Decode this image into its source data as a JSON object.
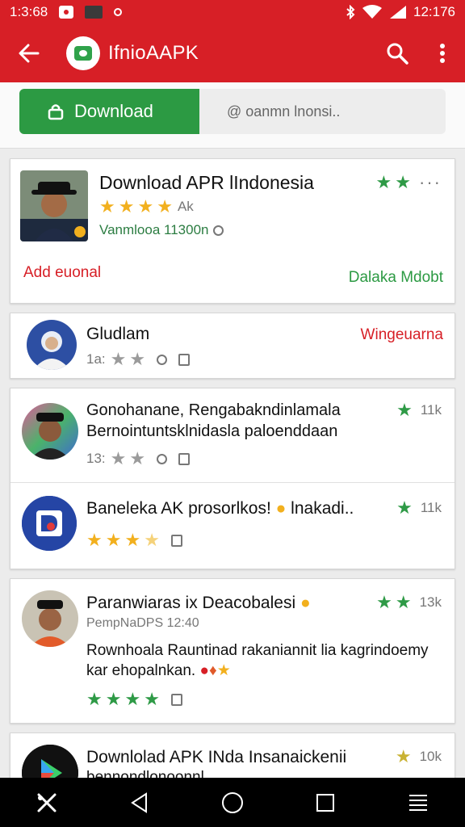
{
  "status_bar": {
    "time_left": "1:3:68",
    "time_right": "12:176"
  },
  "app_bar": {
    "title": "IfnioAAPK"
  },
  "actions": {
    "download_label": "Download",
    "search_placeholder": "@ oanmn lnonsi.."
  },
  "featured": {
    "title": "Download APR lIndonesia",
    "rating_count": "Ak",
    "meta": "Vanmlooa 11300n",
    "left_link": "Add euonal",
    "right_link": "Dalaka Mdobt"
  },
  "items": [
    {
      "title": "Gludlam",
      "sub": "1a:",
      "tag": "Wingeuarna"
    },
    {
      "title": "Gonohanane, Rengabakndinlamala",
      "title2": "Bernointuntsklnidasla paloenddaan",
      "sub": "13:",
      "count": "11k"
    },
    {
      "title": "Baneleka  AK prosorlkos!",
      "title_tail": "lnakadi..",
      "count": "11k"
    },
    {
      "title": "Paranwiaras ix Deacobalesi",
      "meta": "PempNaDPS 12:40",
      "body1": "Rownhoala Rauntinad rakaniannit lia kagrindoemy",
      "body2": "kar ehopalnkan.",
      "count": "13k"
    },
    {
      "title": "Downlolad APK INda Insanaickenii",
      "title2": "bennondlonoonnl",
      "count": "10k"
    }
  ],
  "colors": {
    "brand_red": "#d71f26",
    "download_green": "#2c9a43",
    "star_gold": "#f2b01e",
    "star_green": "#2e9a46"
  },
  "icons": [
    "back-arrow-icon",
    "app-logo-icon",
    "search-icon",
    "more-vert-icon",
    "shield-icon",
    "star-icon",
    "clock-icon",
    "flag-icon",
    "back-nav-icon",
    "home-nav-icon",
    "recents-nav-icon",
    "menu-nav-icon"
  ]
}
